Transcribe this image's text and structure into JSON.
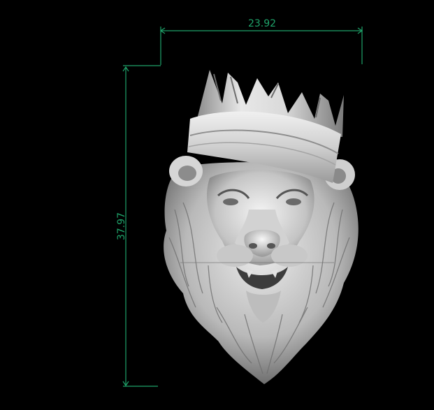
{
  "viewport": {
    "background": "#000000",
    "accent": "#1fa36a",
    "model": "lion-head-with-crown"
  },
  "dimensions": {
    "width_value": "23.92",
    "height_value": "37.97"
  }
}
